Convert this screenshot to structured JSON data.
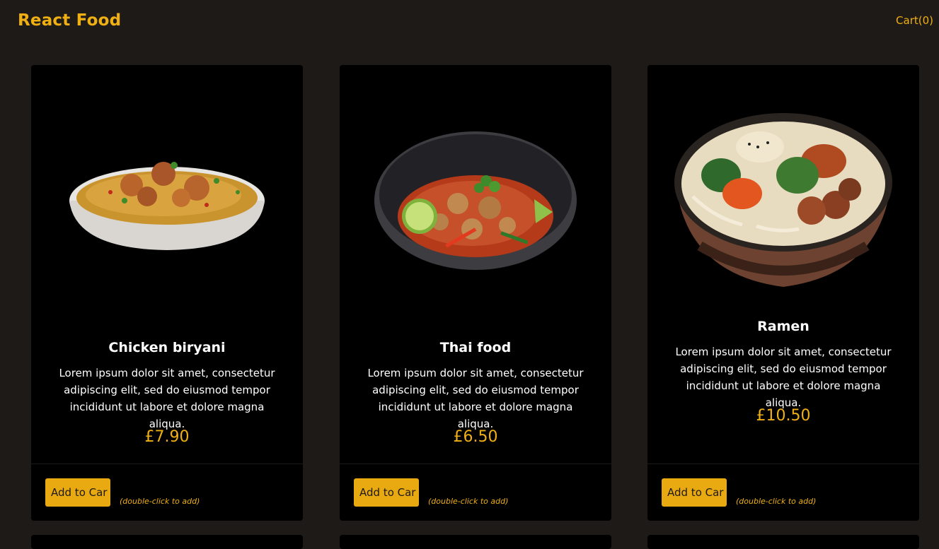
{
  "header": {
    "logo": "React Food",
    "cart_label": "Cart(0)"
  },
  "colors": {
    "background": "#1e1a17",
    "card": "#000000",
    "accent": "#f0b014",
    "button": "#e9a911"
  },
  "menu": {
    "items": [
      {
        "name": "Chicken biryani",
        "description": "Lorem ipsum dolor sit amet, consectetur adipiscing elit, sed do eiusmod tempor incididunt ut labore et dolore magna aliqua.",
        "price": "£7.90",
        "button_label": "Add to Car",
        "hint": "(double-click to add)",
        "image": "biryani-bowl-image"
      },
      {
        "name": "Thai food",
        "description": "Lorem ipsum dolor sit amet, consectetur adipiscing elit, sed do eiusmod tempor incididunt ut labore et dolore magna aliqua.",
        "price": "£6.50",
        "button_label": "Add to Car",
        "hint": "(double-click to add)",
        "image": "thai-curry-bowl-image"
      },
      {
        "name": "Ramen",
        "description": "Lorem ipsum dolor sit amet, consectetur adipiscing elit, sed do eiusmod tempor incididunt ut labore et dolore magna aliqua.",
        "price": "£10.50",
        "button_label": "Add to Car",
        "hint": "(double-click to add)",
        "image": "ramen-bowl-image"
      }
    ]
  }
}
